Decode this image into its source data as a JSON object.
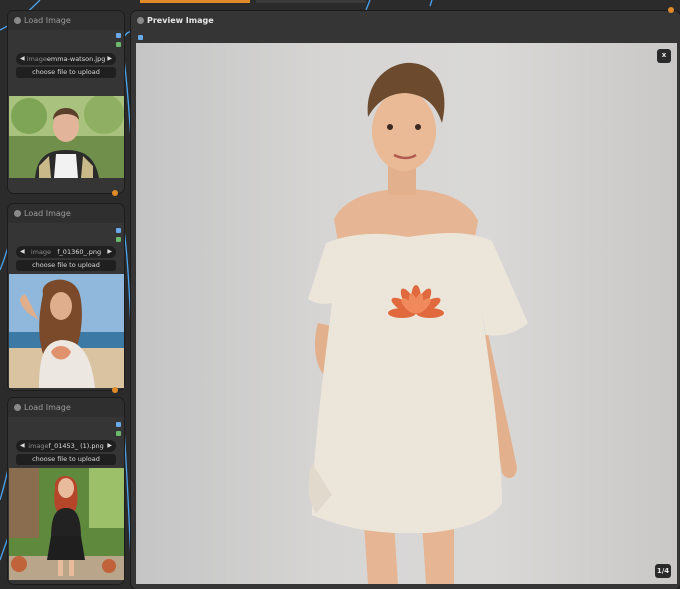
{
  "nodes": [
    {
      "title": "Load Image",
      "image_key": "image",
      "image_value": "emma-watson.jpg",
      "upload_label": "choose file to upload"
    },
    {
      "title": "Load Image",
      "image_key": "image",
      "image_value": "f_01360_.png",
      "upload_label": "choose file to upload"
    },
    {
      "title": "Load Image",
      "image_key": "image",
      "image_value": "f_01453_ (1).png",
      "upload_label": "choose file to upload"
    }
  ],
  "preview": {
    "title": "Preview Image",
    "close_label": "x",
    "counter": "1/4"
  },
  "colors": {
    "canvas": "#2b2b2b",
    "node_bg": "#353535",
    "wire_blue": "#4aa3f0",
    "output_slot_blue": "#6aa9e8",
    "output_slot_green": "#6cb86c",
    "badge_orange": "#e08a2a"
  }
}
